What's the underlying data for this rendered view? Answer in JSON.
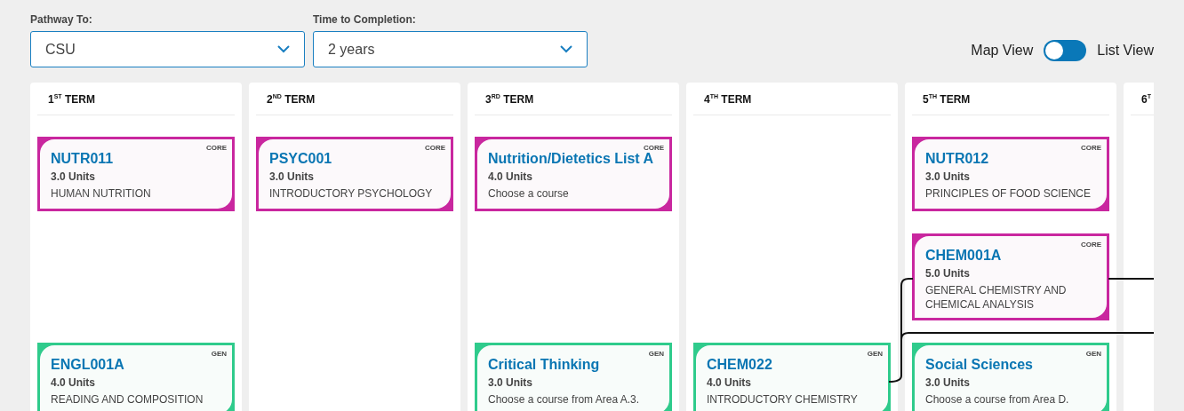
{
  "filters": [
    {
      "label": "Pathway To:",
      "value": "CSU"
    },
    {
      "label": "Time to Completion:",
      "value": "2 years"
    }
  ],
  "view_toggle": {
    "left_label": "Map View",
    "right_label": "List View",
    "on": false
  },
  "terms": [
    {
      "title": "1$^{ST}$ TERM",
      "row_1": {
        "kind": "core",
        "tag": "CORE",
        "title": "NUTR011",
        "units": "3.0 Units",
        "description": "HUMAN NUTRITION"
      },
      "row_3": {
        "kind": "gen",
        "tag": "GEN",
        "title": "ENGL001A",
        "units": "4.0 Units",
        "description": "READING AND COMPOSITION"
      }
    },
    {
      "title": "2$^{ND}$ TERM",
      "row_1": {
        "kind": "core",
        "tag": "CORE",
        "title": "PSYC001",
        "units": "3.0 Units",
        "description": "INTRODUCTORY PSYCHOLOGY"
      }
    },
    {
      "title": "3$^{RD}$ TERM",
      "row_1": {
        "kind": "core",
        "tag": "CORE",
        "title": "Nutrition/Dietetics List A",
        "units": "4.0 Units",
        "description": "Choose a course"
      },
      "row_3": {
        "kind": "gen",
        "tag": "GEN",
        "title": "Critical Thinking",
        "units": "3.0 Units",
        "description": "Choose a course from Area A.3."
      }
    },
    {
      "title": "4$^{TH}$ TERM",
      "row_3": {
        "kind": "gen",
        "tag": "GEN",
        "title": "CHEM022",
        "units": "4.0 Units",
        "description": "INTRODUCTORY CHEMISTRY"
      }
    },
    {
      "title": "5$^{TH}$ TERM",
      "row_1": {
        "kind": "core",
        "tag": "CORE",
        "title": "NUTR012",
        "units": "3.0 Units",
        "description": "PRINCIPLES OF FOOD SCIENCE"
      },
      "row_2": {
        "kind": "core",
        "tag": "CORE",
        "title": "CHEM001A",
        "units": "5.0 Units",
        "description": "GENERAL CHEMISTRY AND CHEMICAL ANALYSIS"
      },
      "row_3": {
        "kind": "gen",
        "tag": "GEN",
        "title": "Social Sciences",
        "units": "3.0 Units",
        "description": "Choose a course from Area D."
      }
    },
    {
      "title": "6$^{T}$"
    }
  ]
}
